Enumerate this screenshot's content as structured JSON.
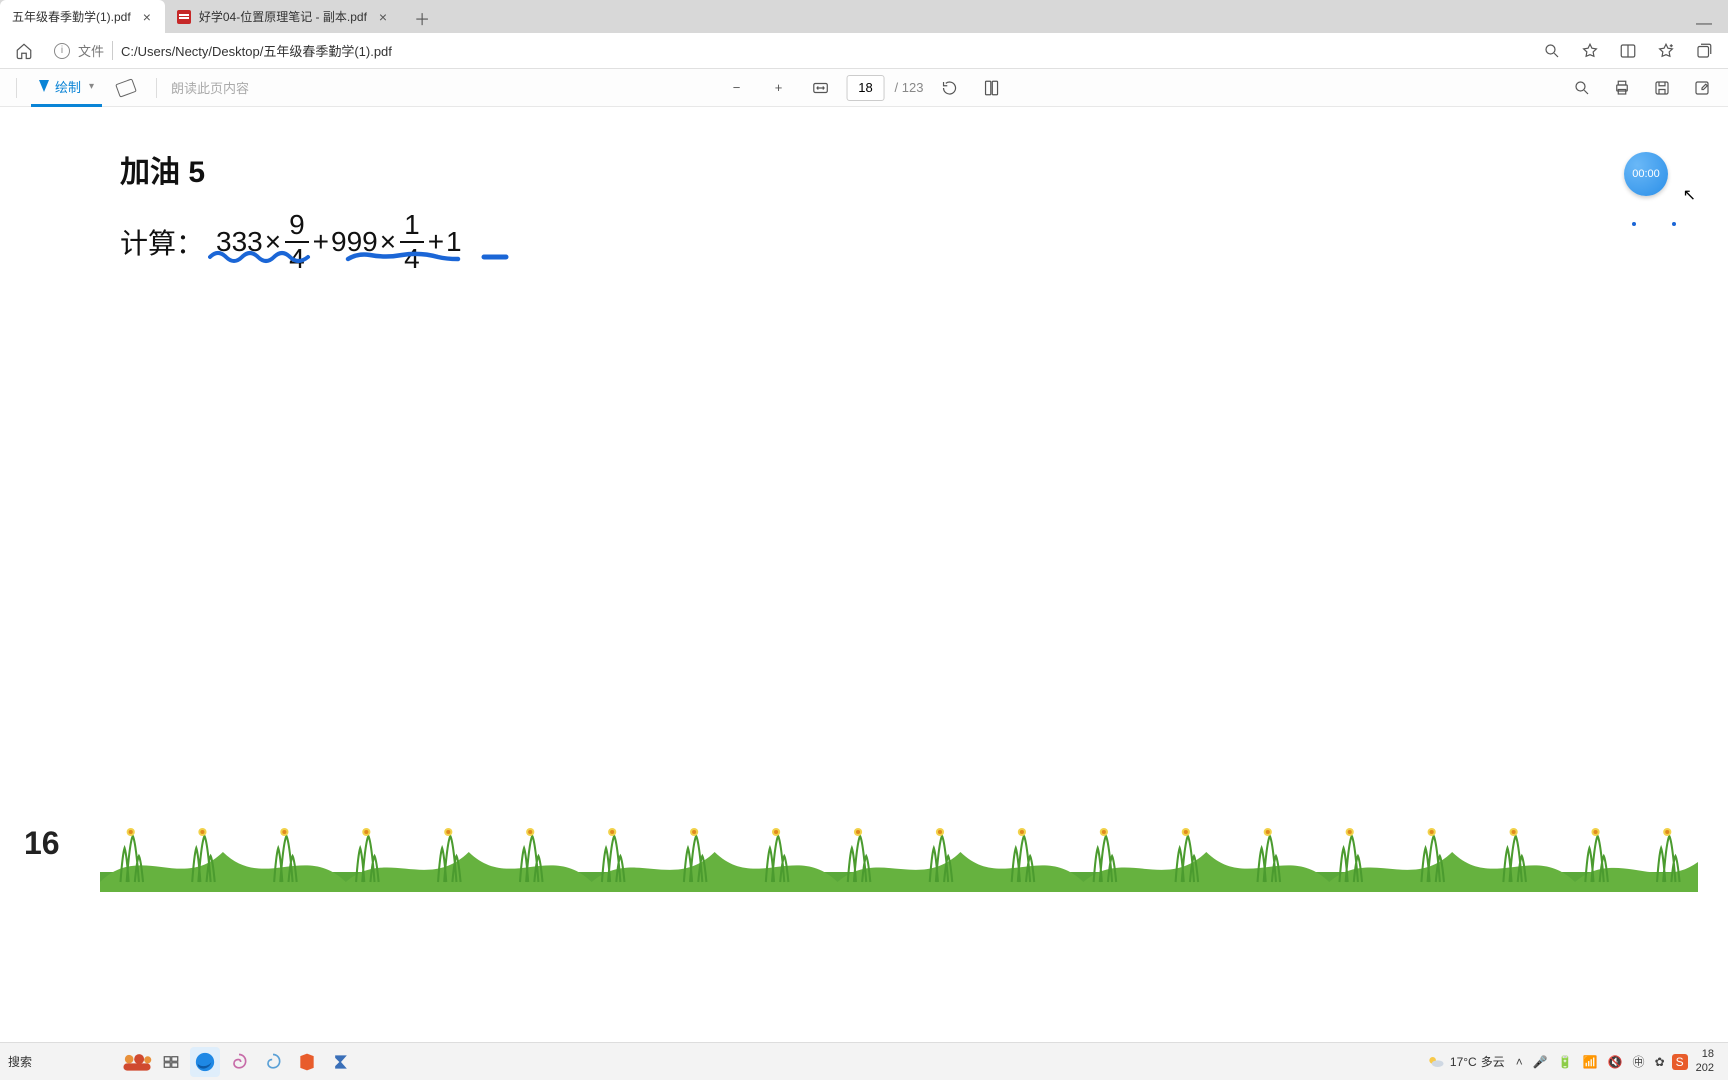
{
  "tabs": [
    {
      "title": "五年级春季勤学(1).pdf",
      "active": true
    },
    {
      "title": "好学04-位置原理笔记 - 副本.pdf",
      "active": false
    }
  ],
  "address": {
    "file_label": "文件",
    "path": "C:/Users/Necty/Desktop/五年级春季勤学(1).pdf"
  },
  "toolbar": {
    "draw": "绘制",
    "tts_placeholder": "朗读此页内容",
    "page_input": "18",
    "page_total": "/ 123"
  },
  "document": {
    "title": "加油 5",
    "calc_label": "计算：",
    "math": {
      "a": "333",
      "f1_num": "9",
      "f1_den": "4",
      "b": "999",
      "f2_num": "1",
      "f2_den": "4",
      "tail": "1"
    },
    "page_num": "16",
    "timer": "00:00"
  },
  "taskbar": {
    "search": "搜索",
    "weather_temp": "17°C",
    "weather_desc": "多云",
    "time": "18",
    "date": "202"
  },
  "colors": {
    "accent": "#0a84d6",
    "ink": "#1b66d6"
  }
}
